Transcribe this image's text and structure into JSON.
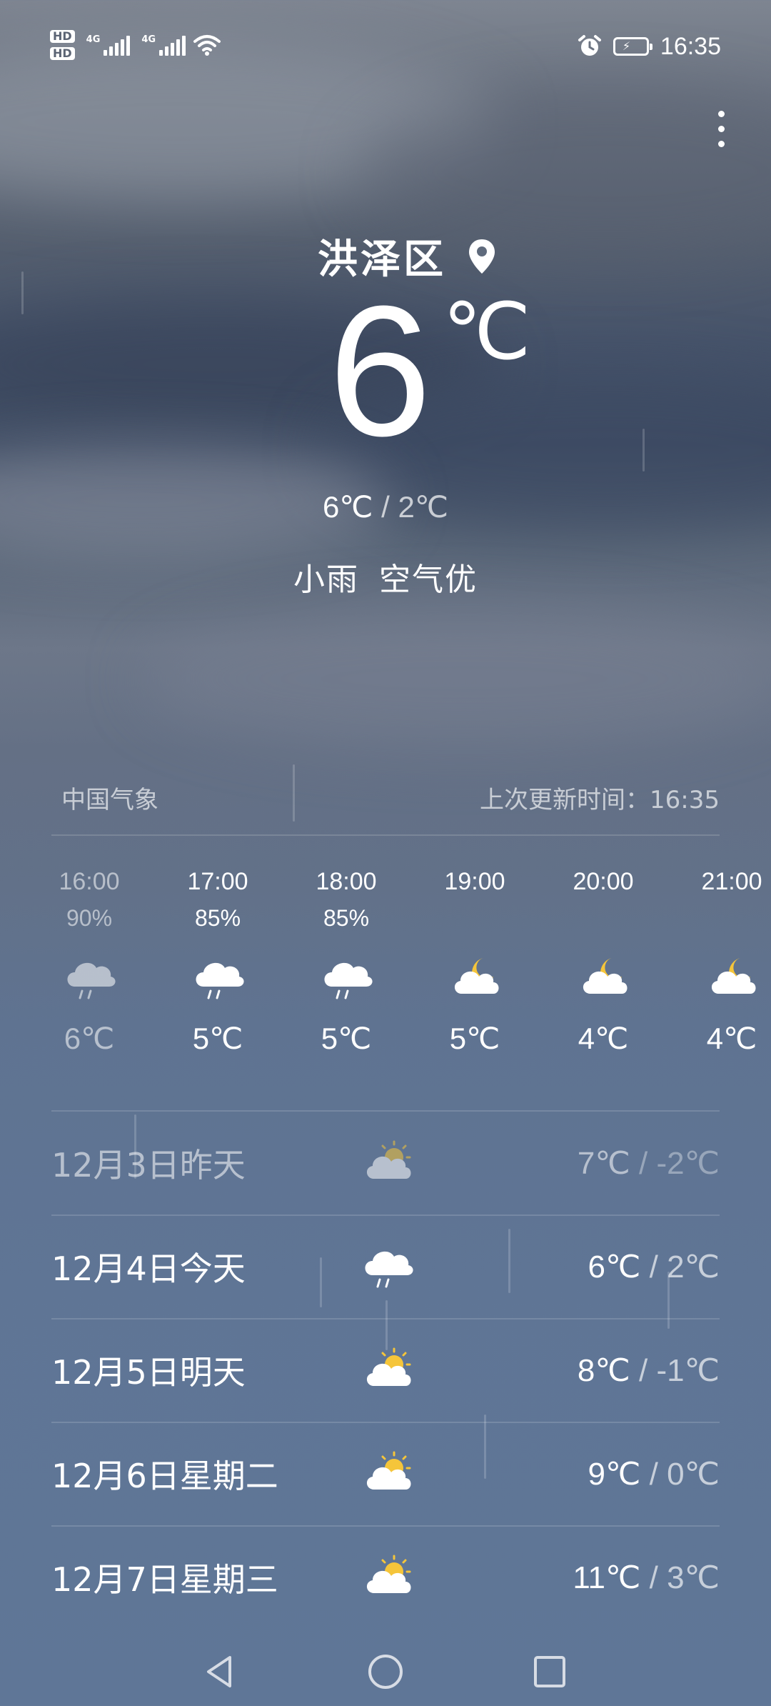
{
  "status_bar": {
    "hd_labels": [
      "HD",
      "HD"
    ],
    "network_labels": [
      "4G",
      "4G"
    ],
    "icons": [
      "wifi-icon",
      "alarm-icon",
      "battery-charging-icon"
    ],
    "time": "16:35"
  },
  "current": {
    "location": "洪泽区",
    "temperature": "6",
    "unit": "℃",
    "high": "6℃",
    "separator": "/",
    "low": "2℃",
    "condition": "小雨",
    "air_quality": "空气优"
  },
  "source": {
    "provider": "中国气象",
    "updated_label": "上次更新时间：16:35"
  },
  "hourly": [
    {
      "time": "16:00",
      "pop": "90%",
      "icon": "rain-cloud-icon",
      "temp": "6℃",
      "dim": true
    },
    {
      "time": "17:00",
      "pop": "85%",
      "icon": "rain-cloud-icon",
      "temp": "5℃",
      "dim": false
    },
    {
      "time": "18:00",
      "pop": "85%",
      "icon": "rain-cloud-icon",
      "temp": "5℃",
      "dim": false
    },
    {
      "time": "19:00",
      "pop": "",
      "icon": "night-cloudy-icon",
      "temp": "5℃",
      "dim": false
    },
    {
      "time": "20:00",
      "pop": "",
      "icon": "night-cloudy-icon",
      "temp": "4℃",
      "dim": false
    },
    {
      "time": "21:00",
      "pop": "",
      "icon": "night-cloudy-icon",
      "temp": "4℃",
      "dim": false
    }
  ],
  "daily": [
    {
      "label": "12月3日昨天",
      "icon": "partly-cloudy-icon",
      "high": "7℃",
      "sep": "/",
      "low": "-2℃",
      "dim": true
    },
    {
      "label": "12月4日今天",
      "icon": "rain-cloud-icon",
      "high": "6℃",
      "sep": "/",
      "low": "2℃",
      "dim": false
    },
    {
      "label": "12月5日明天",
      "icon": "partly-cloudy-icon",
      "high": "8℃",
      "sep": "/",
      "low": "-1℃",
      "dim": false
    },
    {
      "label": "12月6日星期二",
      "icon": "partly-cloudy-icon",
      "high": "9℃",
      "sep": "/",
      "low": "0℃",
      "dim": false
    },
    {
      "label": "12月7日星期三",
      "icon": "partly-cloudy-icon",
      "high": "11℃",
      "sep": "/",
      "low": "3℃",
      "dim": false
    }
  ],
  "colors": {
    "sun": "#f5c53a",
    "cloud": "#ffffff",
    "background_top": "#7e8591",
    "background_bottom": "#5f7697"
  }
}
